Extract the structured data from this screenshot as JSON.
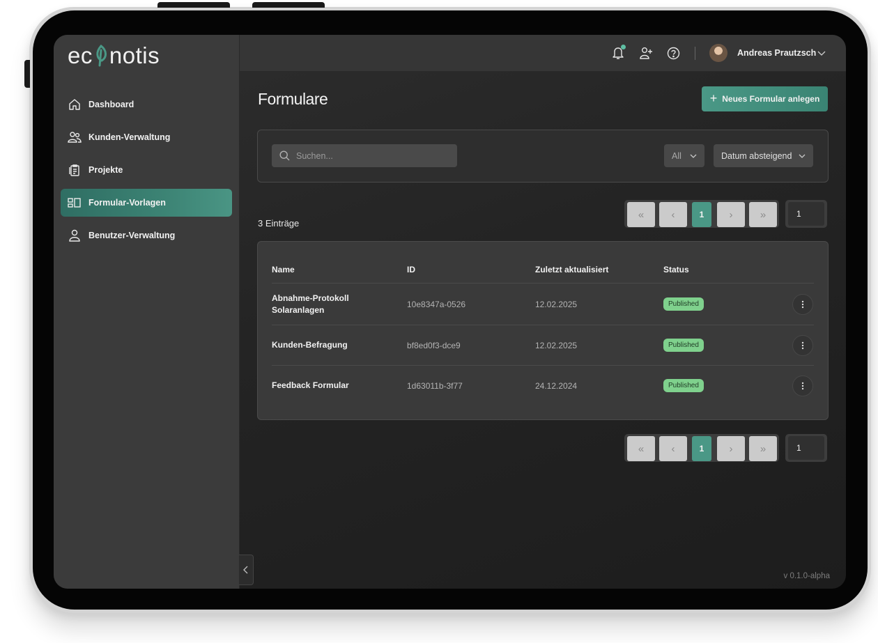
{
  "app": {
    "logo": "econotis",
    "version": "v 0.1.0-alpha"
  },
  "sidebar": {
    "items": [
      {
        "label": "Dashboard",
        "icon": "home-icon",
        "active": false
      },
      {
        "label": "Kunden-Verwaltung",
        "icon": "users-icon",
        "active": false
      },
      {
        "label": "Projekte",
        "icon": "clipboard-icon",
        "active": false
      },
      {
        "label": "Formular-Vorlagen",
        "icon": "layout-icon",
        "active": true
      },
      {
        "label": "Benutzer-Verwaltung",
        "icon": "user-icon",
        "active": false
      }
    ]
  },
  "header": {
    "user_name": "Andreas Prautzsch",
    "icons": [
      "bell-icon",
      "user-plus-icon",
      "help-icon"
    ]
  },
  "page": {
    "title": "Formulare",
    "new_button": "Neues Formular anlegen",
    "search_placeholder": "Suchen...",
    "filter_value": "All",
    "sort_value": "Datum absteigend",
    "entries_count": "3 Einträge"
  },
  "pagination": {
    "first": "«",
    "prev": "‹",
    "current": "1",
    "next": "›",
    "last": "»",
    "page_input": "1"
  },
  "table": {
    "columns": [
      "Name",
      "ID",
      "Zuletzt aktualisiert",
      "Status"
    ],
    "rows": [
      {
        "name": "Abnahme-Protokoll Solaranlagen",
        "id": "10e8347a-0526",
        "updated": "12.02.2025",
        "status": "Published"
      },
      {
        "name": "Kunden-Befragung",
        "id": "bf8ed0f3-dce9",
        "updated": "12.02.2025",
        "status": "Published"
      },
      {
        "name": "Feedback Formular",
        "id": "1d63011b-3f77",
        "updated": "24.12.2024",
        "status": "Published"
      }
    ]
  },
  "colors": {
    "accent": "#3f8b7a",
    "status_published": "#7fd18d",
    "notification_dot": "#5fbfa4"
  }
}
